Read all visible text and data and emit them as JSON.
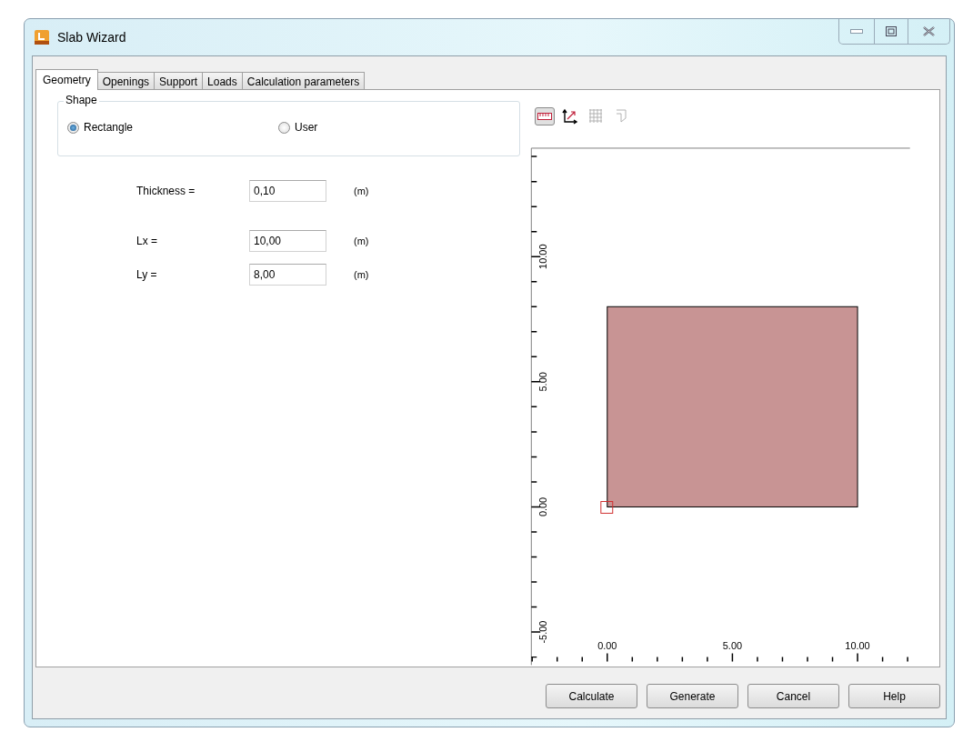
{
  "window": {
    "title": "Slab Wizard"
  },
  "tabs": [
    {
      "label": "Geometry",
      "selected": true
    },
    {
      "label": "Openings",
      "selected": false
    },
    {
      "label": "Support",
      "selected": false
    },
    {
      "label": "Loads",
      "selected": false
    },
    {
      "label": "Calculation parameters",
      "selected": false
    }
  ],
  "shape": {
    "legend": "Shape",
    "options": [
      {
        "label": "Rectangle",
        "selected": true
      },
      {
        "label": "User",
        "selected": false
      }
    ]
  },
  "fields": [
    {
      "label": "Thickness =",
      "value": "0,10",
      "unit": "(m)"
    },
    {
      "label": "Lx =",
      "value": "10,00",
      "unit": "(m)"
    },
    {
      "label": "Ly =",
      "value": "8,00",
      "unit": "(m)"
    }
  ],
  "preview": {
    "tools": [
      {
        "kind": "ruler",
        "selected": true,
        "disabled": false
      },
      {
        "kind": "axes",
        "selected": false,
        "disabled": false
      },
      {
        "kind": "grid",
        "selected": false,
        "disabled": true
      },
      {
        "kind": "outline",
        "selected": false,
        "disabled": true
      }
    ],
    "x_labels": [
      "0.00",
      "5.00",
      "10.00"
    ],
    "y_labels": [
      "-5.00",
      "0.00",
      "5.00",
      "10.00"
    ]
  },
  "buttons": [
    "Calculate",
    "Generate",
    "Cancel",
    "Help"
  ]
}
